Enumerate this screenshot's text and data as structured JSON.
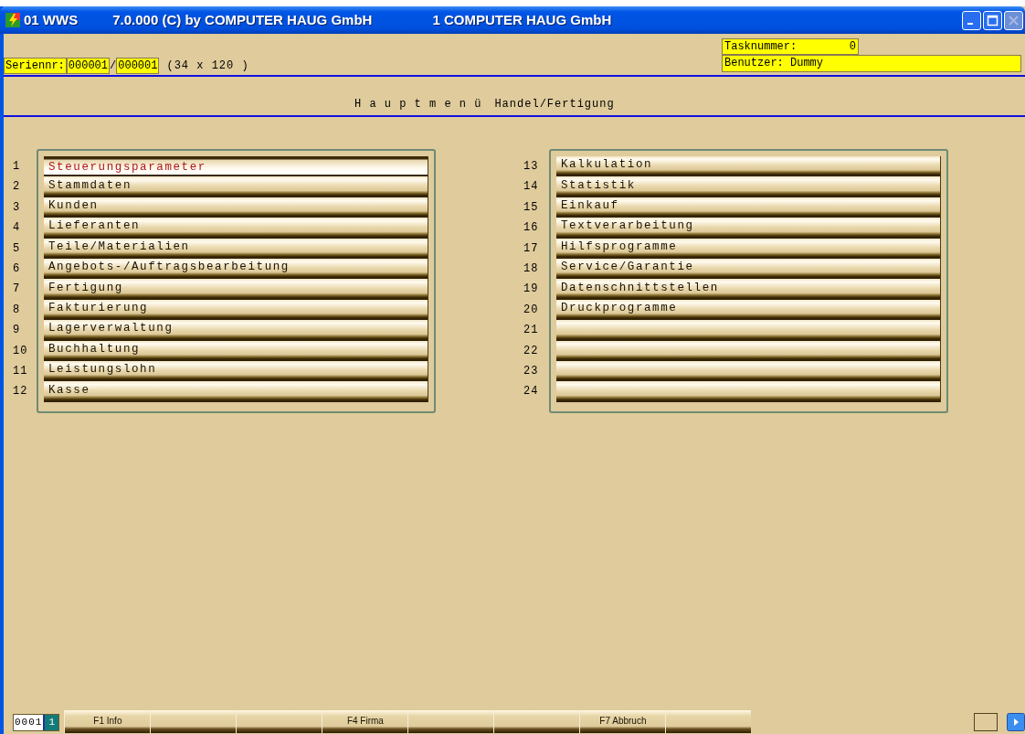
{
  "window": {
    "title_parts": [
      "01 WWS",
      "7.0.000 (C) by COMPUTER HAUG GmbH",
      "1 COMPUTER HAUG GmbH"
    ],
    "close_disabled": true
  },
  "header": {
    "serial_label": "Seriennr:",
    "serial_1": "000001",
    "serial_sep": "/",
    "serial_2": "000001",
    "screen_size": "(34 x 120 )",
    "task_label": "Tasknummer:",
    "task_value": "0",
    "user": "Benutzer: Dummy"
  },
  "heading": {
    "title": "H a u p t m e n ü",
    "subtitle": "Handel/Fertigung"
  },
  "menu_left": [
    {
      "number": "1",
      "label": "Steuerungsparameter",
      "selected": true
    },
    {
      "number": "2",
      "label": "Stammdaten",
      "selected": false
    },
    {
      "number": "3",
      "label": "Kunden",
      "selected": false
    },
    {
      "number": "4",
      "label": "Lieferanten",
      "selected": false
    },
    {
      "number": "5",
      "label": "Teile/Materialien",
      "selected": false
    },
    {
      "number": "6",
      "label": "Angebots-/Auftragsbearbeitung",
      "selected": false
    },
    {
      "number": "7",
      "label": "Fertigung",
      "selected": false
    },
    {
      "number": "8",
      "label": "Fakturierung",
      "selected": false
    },
    {
      "number": "9",
      "label": "Lagerverwaltung",
      "selected": false
    },
    {
      "number": "10",
      "label": "Buchhaltung",
      "selected": false
    },
    {
      "number": "11",
      "label": "Leistungslohn",
      "selected": false
    },
    {
      "number": "12",
      "label": "Kasse",
      "selected": false
    }
  ],
  "menu_right": [
    {
      "number": "13",
      "label": "Kalkulation",
      "selected": false
    },
    {
      "number": "14",
      "label": "Statistik",
      "selected": false
    },
    {
      "number": "15",
      "label": "Einkauf",
      "selected": false
    },
    {
      "number": "16",
      "label": "Textverarbeitung",
      "selected": false
    },
    {
      "number": "17",
      "label": "Hilfsprogramme",
      "selected": false
    },
    {
      "number": "18",
      "label": "Service/Garantie",
      "selected": false
    },
    {
      "number": "19",
      "label": "Datenschnittstellen",
      "selected": false
    },
    {
      "number": "20",
      "label": "Druckprogramme",
      "selected": false
    },
    {
      "number": "21",
      "selected": false
    },
    {
      "number": "22",
      "selected": false
    },
    {
      "number": "23",
      "selected": false
    },
    {
      "number": "24",
      "selected": false
    }
  ],
  "status_bar": {
    "counter": "0001",
    "page": "1",
    "function_keys": [
      {
        "kind": "labeled",
        "label": "F1 Info"
      },
      {
        "kind": "blank"
      },
      {
        "kind": "blank"
      },
      {
        "kind": "labeled",
        "label": "F4 Firma"
      },
      {
        "kind": "blank"
      },
      {
        "kind": "blank"
      },
      {
        "kind": "labeled",
        "label": "F7 Abbruch"
      },
      {
        "kind": "blank"
      }
    ]
  }
}
